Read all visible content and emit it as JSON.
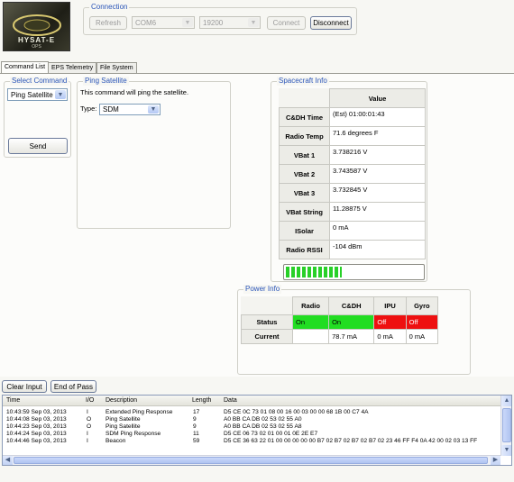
{
  "logo": {
    "text": "HYSAT-E",
    "sub": "OPS"
  },
  "connection": {
    "title": "Connection",
    "refresh_label": "Refresh",
    "port_value": "COM6",
    "baud_value": "19200",
    "connect_label": "Connect",
    "disconnect_label": "Disconnect"
  },
  "tabs": [
    "Command List",
    "EPS Telemetry",
    "File System"
  ],
  "select_command": {
    "title": "Select Command",
    "value": "Ping Satellite",
    "send_label": "Send"
  },
  "ping": {
    "title": "Ping Satellite",
    "description": "This command will ping the satellite.",
    "type_label": "Type:",
    "type_value": "SDM"
  },
  "spacecraft": {
    "title": "Spacecraft Info",
    "value_header": "Value",
    "rows": [
      {
        "label": "C&DH Time",
        "value": "(Est) 01:00:01:43"
      },
      {
        "label": "Radio Temp",
        "value": "71.6 degrees F"
      },
      {
        "label": "VBat 1",
        "value": "3.738216 V"
      },
      {
        "label": "VBat 2",
        "value": "3.743587 V"
      },
      {
        "label": "VBat 3",
        "value": "3.732845 V"
      },
      {
        "label": "VBat String",
        "value": "11.28875 V"
      },
      {
        "label": "ISolar",
        "value": "0 mA"
      },
      {
        "label": "Radio RSSI",
        "value": "-104 dBm"
      }
    ],
    "signal_level": 0.4,
    "signal_color": "#28d028"
  },
  "power": {
    "title": "Power Info",
    "headers": [
      "Radio",
      "C&DH",
      "IPU",
      "Gyro"
    ],
    "status_label": "Status",
    "current_label": "Current",
    "status": [
      "On",
      "On",
      "Off",
      "Off"
    ],
    "status_colors": [
      "#22dd22",
      "#22dd22",
      "#ee1010",
      "#ee1010"
    ],
    "current": [
      "",
      "78.7 mA",
      "0 mA",
      "0 mA"
    ]
  },
  "log_buttons": {
    "clear_label": "Clear Input",
    "end_label": "End of Pass"
  },
  "log": {
    "headers": [
      "Time",
      "I/O",
      "Description",
      "Length",
      "Data"
    ],
    "rows": [
      [
        "10:43:59 Sep 03, 2013",
        "I",
        "Extended Ping Response",
        "17",
        "D5 CE 0C 73 01 08 00 16 00 03 00 00 68 1B 00 C7 4A"
      ],
      [
        "10:44:08 Sep 03, 2013",
        "O",
        "Ping Satellite",
        "9",
        "A0 BB CA DB 02 53 02 55 A0"
      ],
      [
        "10:44:23 Sep 03, 2013",
        "O",
        "Ping Satellite",
        "9",
        "A0 BB CA DB 02 53 02 55 A8"
      ],
      [
        "10:44:24 Sep 03, 2013",
        "I",
        "SDM Ping Response",
        "11",
        "D5 CE 06 73 02 01 00 01 0E 2E E7"
      ],
      [
        "10:44:46 Sep 03, 2013",
        "I",
        "Beacon",
        "59",
        "D5 CE 36 63 22 01 00 00 00 00 00 B7 02 B7 02 B7 02 B7 02 23 46 FF F4 0A 42 00 02 03 13 FF"
      ]
    ]
  }
}
